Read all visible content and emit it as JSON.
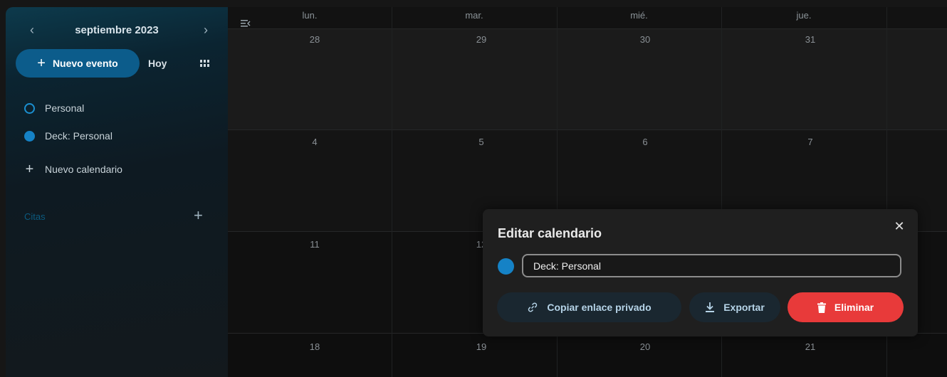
{
  "sidebar": {
    "month_label": "septiembre 2023",
    "prev_icon": "chevron-left-icon",
    "next_icon": "chevron-right-icon",
    "new_event_label": "Nuevo evento",
    "today_label": "Hoy",
    "calendars": [
      {
        "label": "Personal",
        "style": "outline"
      },
      {
        "label": "Deck: Personal",
        "style": "filled"
      }
    ],
    "new_calendar_label": "Nuevo calendario",
    "section_label": "Citas"
  },
  "calendar": {
    "day_headers": [
      "lun.",
      "mar.",
      "mié.",
      "jue."
    ],
    "weeks": [
      [
        "28",
        "29",
        "30",
        "31"
      ],
      [
        "4",
        "5",
        "6",
        "7"
      ],
      [
        "11",
        "12",
        "",
        ""
      ],
      [
        "18",
        "19",
        "20",
        "21"
      ]
    ]
  },
  "modal": {
    "title": "Editar calendario",
    "close_icon": "close-icon",
    "name_value": "Deck: Personal",
    "copy_label": "Copiar enlace privado",
    "export_label": "Exportar",
    "delete_label": "Eliminar"
  },
  "colors": {
    "accent": "#0c5c8b",
    "calendar_color": "#1582c6",
    "danger": "#e83a3a",
    "background": "#121212"
  }
}
